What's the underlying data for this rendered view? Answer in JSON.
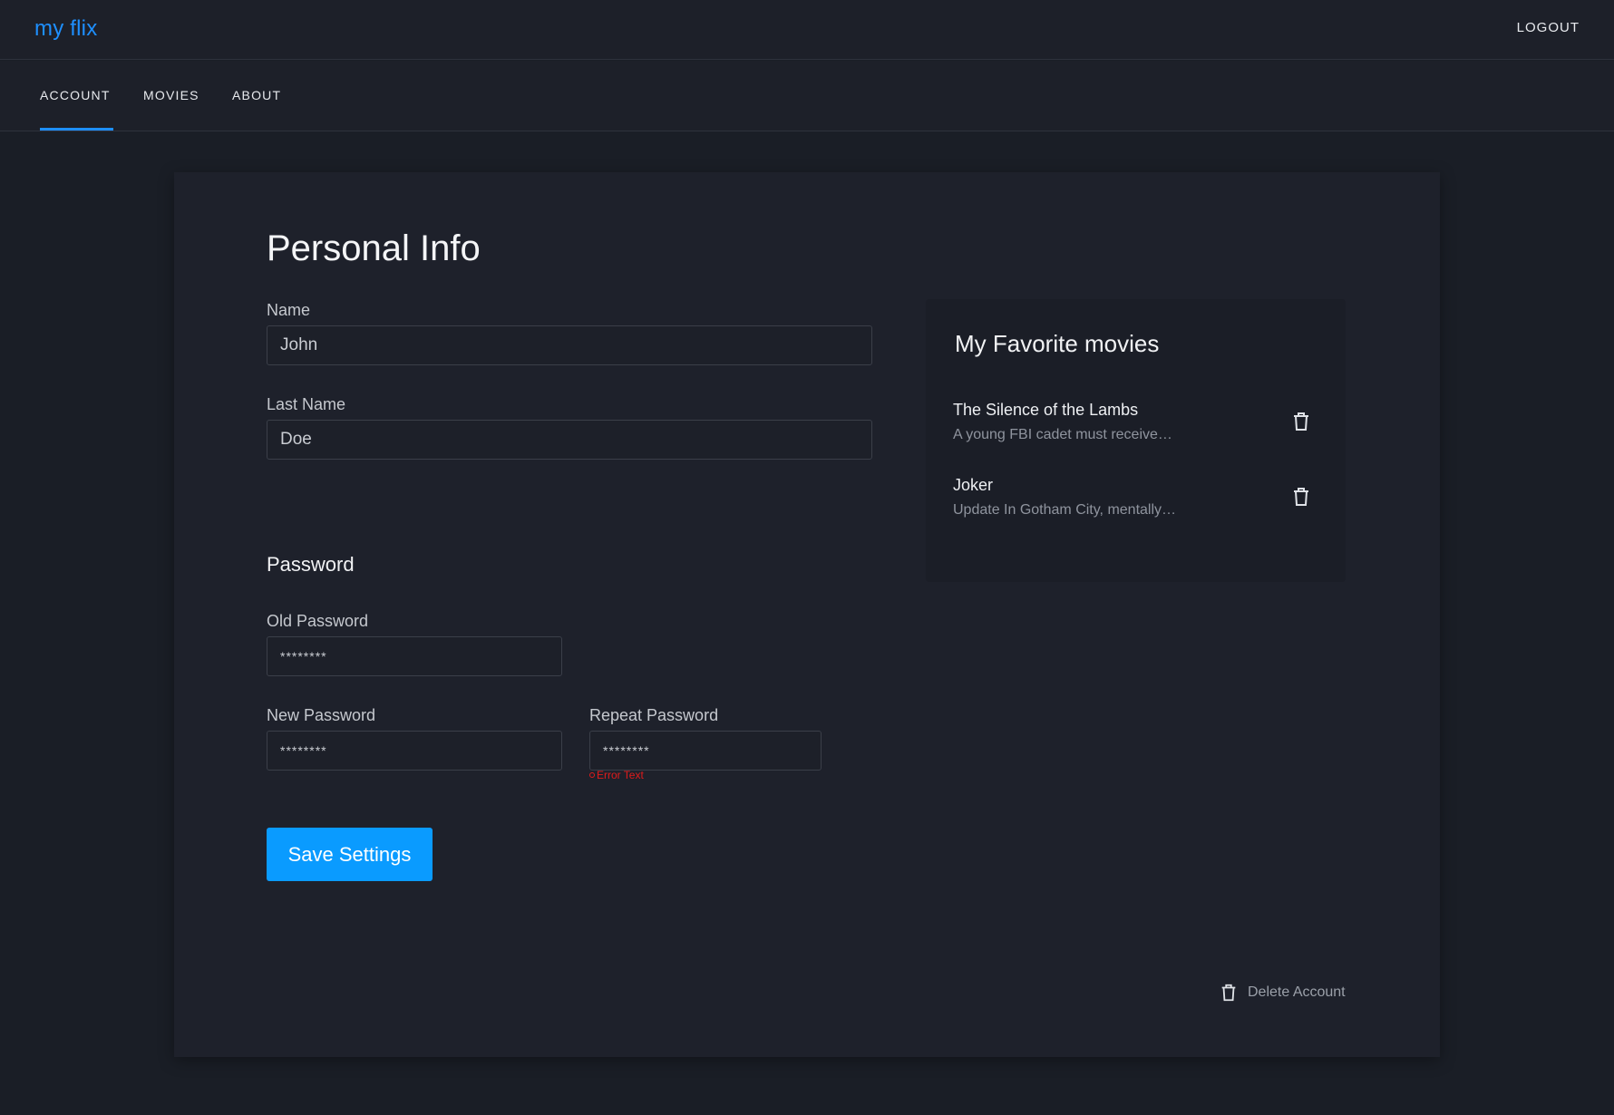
{
  "header": {
    "logo": "my flix",
    "logout_label": "LOGOUT"
  },
  "nav": {
    "tabs": [
      {
        "label": "ACCOUNT",
        "active": true
      },
      {
        "label": "MOVIES",
        "active": false
      },
      {
        "label": "ABOUT",
        "active": false
      }
    ]
  },
  "personal_info": {
    "title": "Personal Info",
    "name_label": "Name",
    "name_value": "John",
    "last_name_label": "Last Name",
    "last_name_value": "Doe"
  },
  "password": {
    "title": "Password",
    "old_label": "Old Password",
    "old_value": "********",
    "new_label": "New Password",
    "new_value": "********",
    "repeat_label": "Repeat Password",
    "repeat_value": "********",
    "error_text": "Error Text"
  },
  "save_button_label": "Save Settings",
  "favorites": {
    "title": "My Favorite movies",
    "items": [
      {
        "title": "The Silence of the Lambs",
        "description": "A young FBI cadet must receive…"
      },
      {
        "title": "Joker",
        "description": "Update In Gotham City, mentally…"
      }
    ]
  },
  "delete_account_label": "Delete Account",
  "colors": {
    "accent": "#1e8fff",
    "button": "#0a9bff",
    "error": "#e01b1b",
    "background": "#1a1e26"
  },
  "icons": [
    "trash-icon"
  ]
}
